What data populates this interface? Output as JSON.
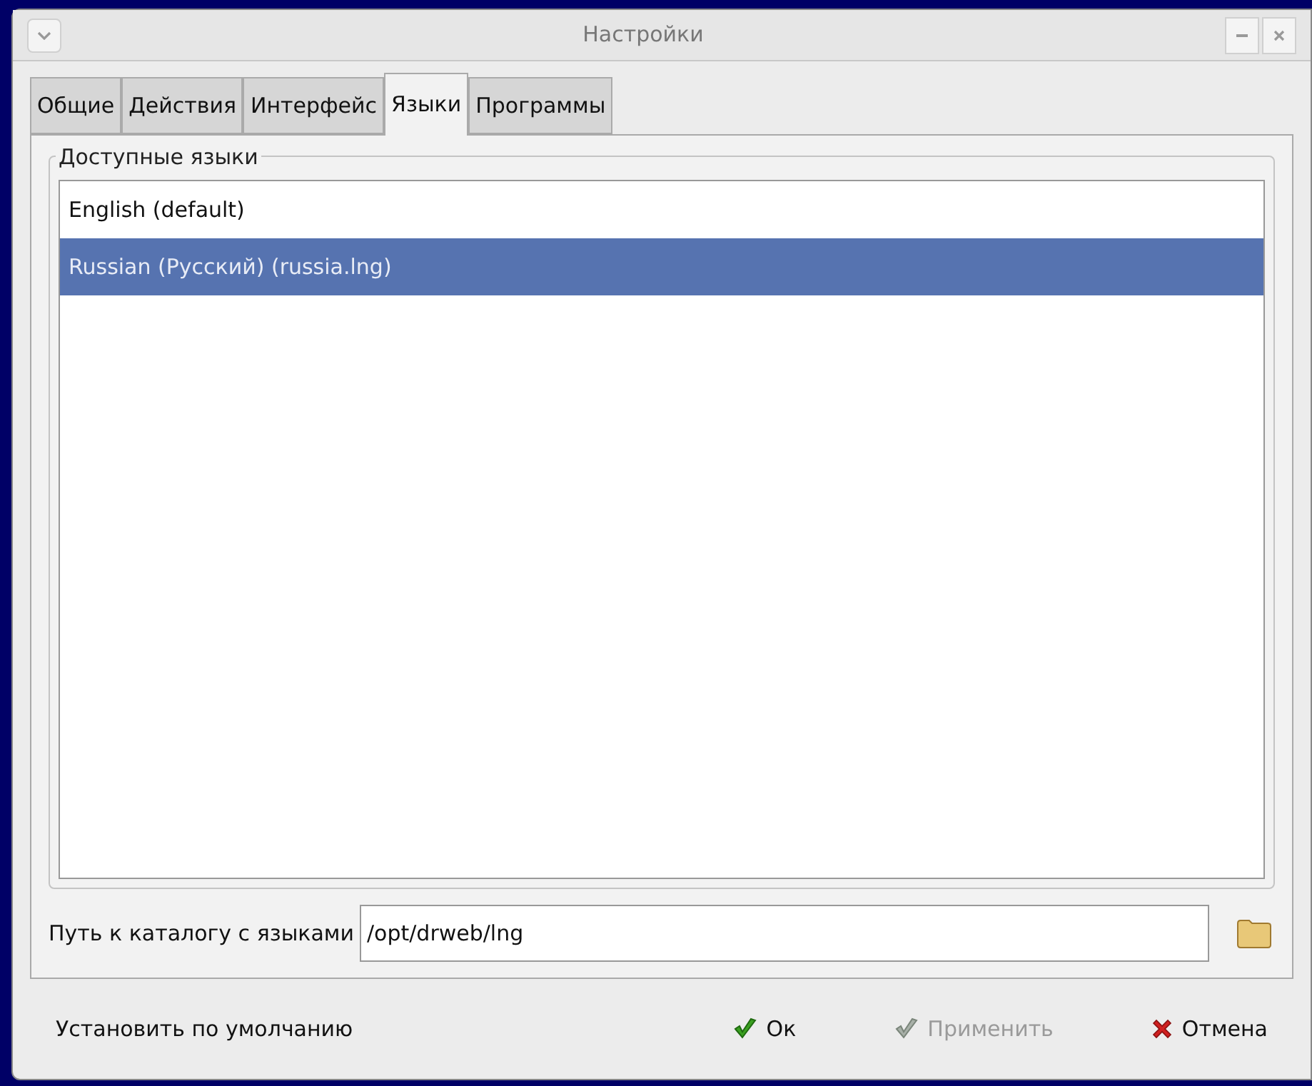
{
  "window": {
    "title": "Настройки"
  },
  "tabs": [
    {
      "label": "Общие",
      "selected": false
    },
    {
      "label": "Действия",
      "selected": false
    },
    {
      "label": "Интерфейс",
      "selected": false
    },
    {
      "label": "Языки",
      "selected": true
    },
    {
      "label": "Программы",
      "selected": false
    }
  ],
  "group": {
    "title": "Доступные языки"
  },
  "languages": [
    {
      "label": "English (default)",
      "selected": false
    },
    {
      "label": "Russian (Русский) (russia.lng)",
      "selected": true
    }
  ],
  "path": {
    "label": "Путь к каталогу с языками",
    "value": "/opt/drweb/lng"
  },
  "buttons": [
    {
      "kind": "plain",
      "label": "Установить по умолчанию",
      "disabled": false
    },
    {
      "kind": "ok",
      "label": "Ок",
      "disabled": false
    },
    {
      "kind": "apply",
      "label": "Применить",
      "disabled": true
    },
    {
      "kind": "cancel",
      "label": "Отмена",
      "disabled": false
    }
  ]
}
